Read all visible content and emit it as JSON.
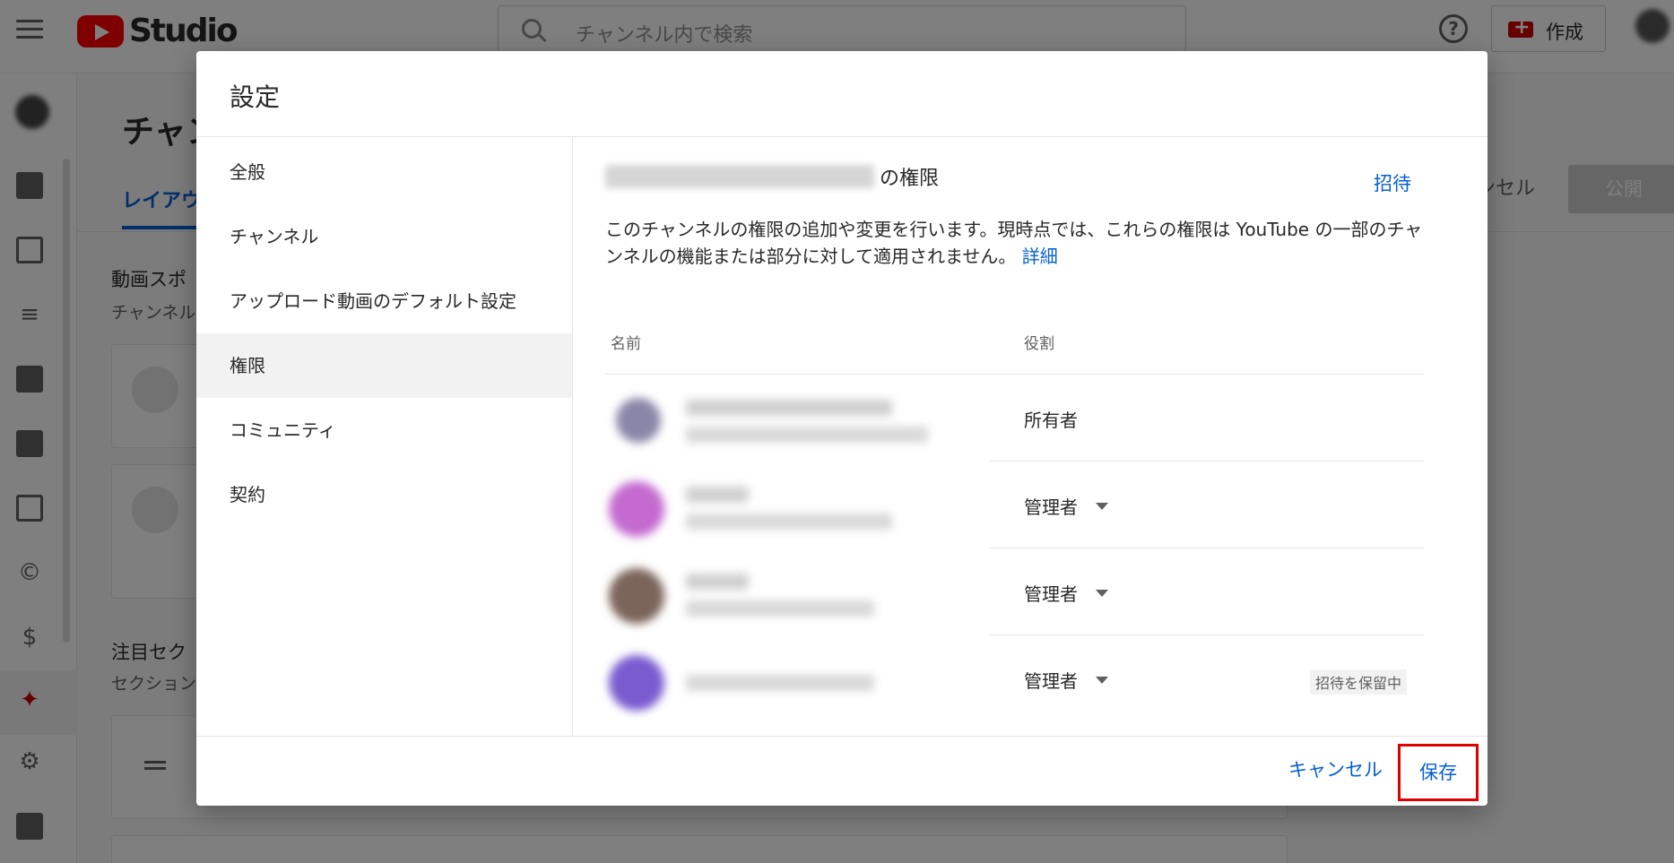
{
  "app": {
    "logo_text": "Studio",
    "search_placeholder": "チャンネル内で検索",
    "help_glyph": "?",
    "create_label": "作成"
  },
  "background": {
    "page_title": "チャン",
    "tab_layout": "レイアウ",
    "cancel": "ンセル",
    "publish": "公開",
    "section1_title": "動画スポ",
    "section1_sub": "チャンネル",
    "section2_title": "注目セク",
    "section2_sub": "セクション"
  },
  "dialog": {
    "title": "設定",
    "sidebar": [
      {
        "label": "全般"
      },
      {
        "label": "チャンネル"
      },
      {
        "label": "アップロード動画のデフォルト設定"
      },
      {
        "label": "権限",
        "active": true
      },
      {
        "label": "コミュニティ"
      },
      {
        "label": "契約"
      }
    ],
    "permissions": {
      "heading_suffix": "の権限",
      "invite": "招待",
      "description": "このチャンネルの権限の追加や変更を行います。現時点では、これらの権限は YouTube の一部のチャンネルの機能または部分に対して適用されません。",
      "learn_more": "詳細",
      "columns": {
        "name": "名前",
        "role": "役割"
      },
      "rows": [
        {
          "role": "所有者",
          "dropdown": false,
          "avatar_color": "#8a86a8"
        },
        {
          "role": "管理者",
          "dropdown": true,
          "avatar_color": "#c46ad0"
        },
        {
          "role": "管理者",
          "dropdown": true,
          "avatar_color": "#7b6459"
        },
        {
          "role": "管理者",
          "dropdown": true,
          "avatar_color": "#7a5bd0",
          "badge": "招待を保留中"
        }
      ]
    },
    "footer": {
      "cancel": "キャンセル",
      "save": "保存"
    }
  },
  "colors": {
    "link_blue": "#065fd4",
    "youtube_red": "#ff0000",
    "highlight_red": "#e00000"
  }
}
